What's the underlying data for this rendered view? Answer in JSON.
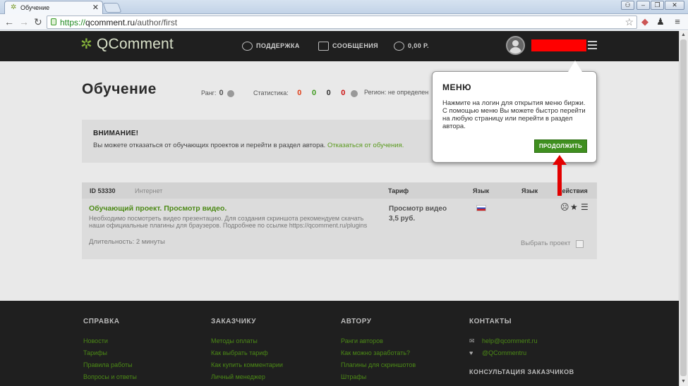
{
  "browser": {
    "tab_title": "Обучение",
    "url_scheme": "https://",
    "url_domain": "qcomment.ru",
    "url_path": "/author/first"
  },
  "header": {
    "logo": "QComment",
    "support": "ПОДДЕРЖКА",
    "messages": "СООБЩЕНИЯ",
    "balance": "0,00 Р."
  },
  "page": {
    "title": "Обучение",
    "rank_label": "Ранг:",
    "rank_value": "0",
    "stats_label": "Статистика:",
    "stats": [
      {
        "value": "0",
        "color": "#e0401a"
      },
      {
        "value": "0",
        "color": "#3f9a1e"
      },
      {
        "value": "0",
        "color": "#333333"
      },
      {
        "value": "0",
        "color": "#cc1010"
      }
    ],
    "region": "Регион: не определен"
  },
  "notice": {
    "title": "ВНИМАНИЕ!",
    "text": "Вы можете отказаться от обучающих проектов и перейти в раздел автора.",
    "link": "Отказаться от обучения."
  },
  "table": {
    "headers": {
      "id": "ID 53330",
      "type": "Интернет",
      "tariff": "Тариф",
      "lang": "Язык",
      "lang2": "Язык",
      "actions": "Действия"
    },
    "project": {
      "title": "Обучающий проект. Просмотр видео.",
      "description": "Необходимо посмотреть видео презентацию. Для создания скриншота рекомендуем скачать наши официальные плагины для браузеров. Подробнее по ссылке https://qcomment.ru/plugins",
      "duration": "Длительность: 2 минуты",
      "tariff_name": "Просмотр видео",
      "tariff_price": "3,5 руб.",
      "choose": "Выбрать проект"
    }
  },
  "popup": {
    "title": "МЕНЮ",
    "text": "Нажмите на логин для открытия меню биржи. С помощью меню Вы можете быстро перейти на любую страницу или перейти в раздел автора.",
    "button": "ПРОДОЛЖИТЬ"
  },
  "footer": {
    "help": {
      "title": "СПРАВКА",
      "links": [
        "Новости",
        "Тарифы",
        "Правила работы",
        "Вопросы и ответы"
      ]
    },
    "customer": {
      "title": "ЗАКАЗЧИКУ",
      "links": [
        "Методы оплаты",
        "Как выбрать тариф",
        "Как купить комментарии",
        "Личный менеджер"
      ]
    },
    "author": {
      "title": "АВТОРУ",
      "links": [
        "Ранги авторов",
        "Как можно заработать?",
        "Плагины для скриншотов",
        "Штрафы"
      ]
    },
    "contacts": {
      "title": "КОНТАКТЫ",
      "email": "help@qcomment.ru",
      "twitter": "@QCommentru",
      "consult": "КОНСУЛЬТАЦИЯ ЗАКАЗЧИКОВ"
    }
  }
}
